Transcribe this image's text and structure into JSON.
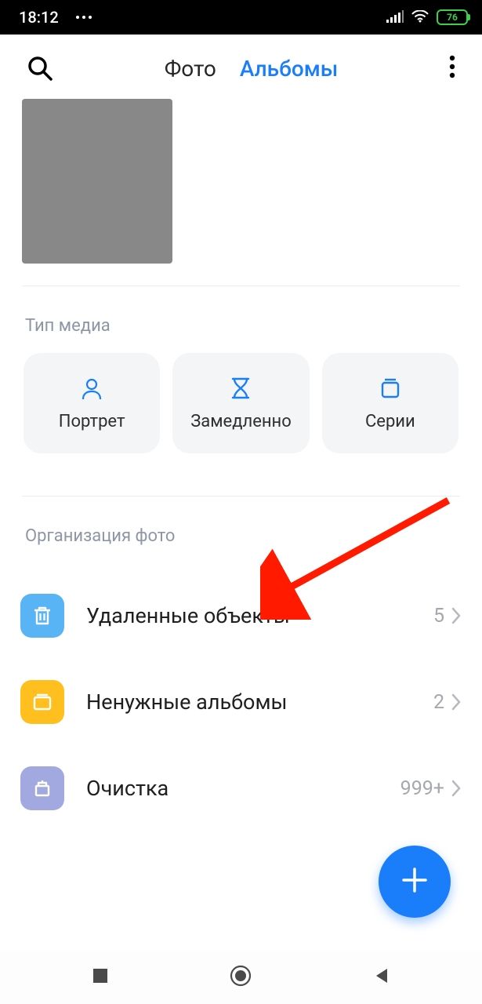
{
  "status": {
    "time": "18:12",
    "battery": "76"
  },
  "tabs": {
    "photos": "Фото",
    "albums": "Альбомы"
  },
  "sections": {
    "media_type": "Тип медиа",
    "organization": "Организация фото"
  },
  "media_cards": {
    "portrait": "Портрет",
    "slowmo": "Замедленно",
    "burst": "Серии"
  },
  "org": {
    "deleted": {
      "label": "Удаленные объекты",
      "count": "5"
    },
    "unneeded": {
      "label": "Ненужные альбомы",
      "count": "2"
    },
    "cleanup": {
      "label": "Очистка",
      "count": "999+"
    }
  }
}
